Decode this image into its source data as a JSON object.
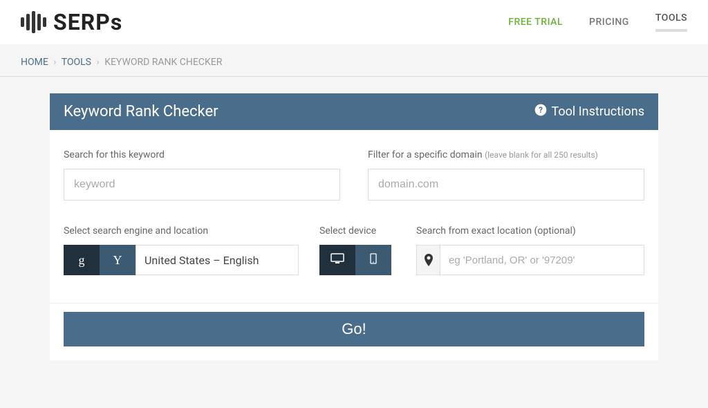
{
  "logo_text": "SERPs",
  "nav": {
    "free_trial": "FREE TRIAL",
    "pricing": "PRICING",
    "tools": "TOOLS"
  },
  "breadcrumb": {
    "home": "HOME",
    "tools": "TOOLS",
    "current": "KEYWORD RANK CHECKER",
    "sep": "›"
  },
  "card": {
    "title": "Keyword Rank Checker",
    "instructions": "Tool Instructions"
  },
  "fields": {
    "keyword_label": "Search for this keyword",
    "keyword_placeholder": "keyword",
    "domain_label": "Filter for a specific domain ",
    "domain_hint": "(leave blank for all 250 results)",
    "domain_placeholder": "domain.com",
    "engine_label": "Select search engine and location",
    "engine_select": "United States – English",
    "device_label": "Select device",
    "location_label": "Search from exact location (optional)",
    "location_placeholder": "eg 'Portland, OR' or '97209'"
  },
  "go": "Go!"
}
